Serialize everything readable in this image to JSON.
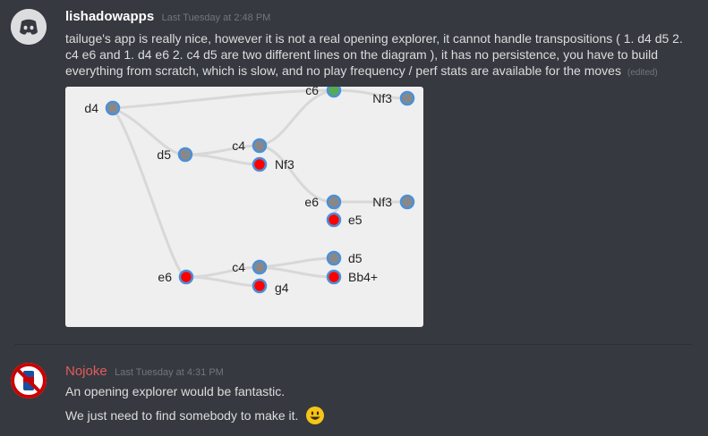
{
  "messages": [
    {
      "author": "lishadowapps",
      "timestamp": "Last Tuesday at 2:48 PM",
      "text": "tailuge's app is really nice, however it is not a real opening explorer, it cannot handle transpositions ( 1. d4 d5 2. c4 e6 and 1. d4 e6 2. c4 d5 are two different lines on the diagram ), it has no persistence, you have to build everything from scratch, which is slow, and no play frequency / perf stats are available for the moves",
      "edited": "(edited)",
      "diagram": {
        "labels": [
          "d4",
          "c6",
          "Nf3",
          "d5",
          "c4",
          "Nf3",
          "e6",
          "Nf3",
          "e5",
          "e6",
          "c4",
          "d5",
          "Bb4+",
          "g4"
        ]
      }
    },
    {
      "author": "Nojoke",
      "timestamp": "Last Tuesday at 4:31 PM",
      "lines": [
        "An opening explorer would be fantastic.",
        "We just need to find somebody to make it."
      ],
      "emoji": "smiley-emoji"
    }
  ],
  "colors": {
    "background": "#36393f",
    "author1": "#ffffff",
    "author2": "#e25c5c",
    "node_gray": "#888888",
    "node_red": "#ff0000",
    "node_green": "#55aa55",
    "node_border": "#4a90d9"
  }
}
